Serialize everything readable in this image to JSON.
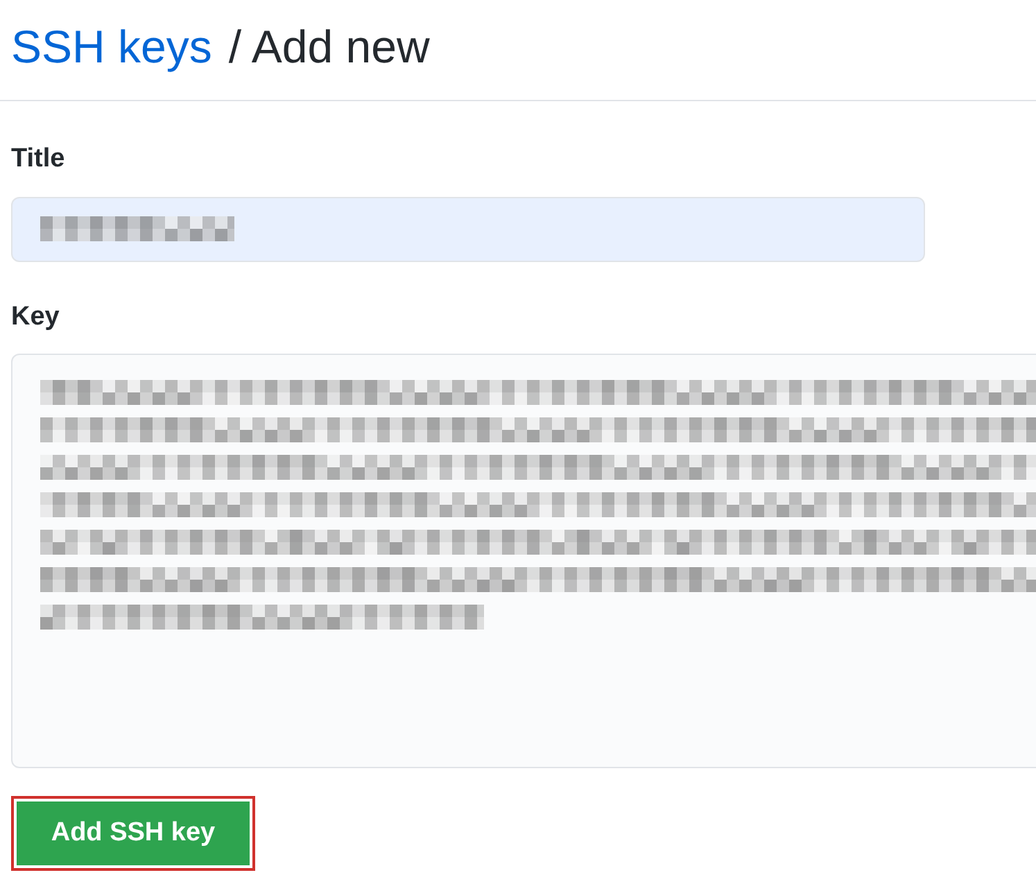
{
  "heading": {
    "link": "SSH keys",
    "rest": "/ Add new"
  },
  "title_field": {
    "label": "Title",
    "redacted": true,
    "autofilled": true
  },
  "key_field": {
    "label": "Key",
    "redacted": true
  },
  "buttons": [
    "Add SSH key"
  ],
  "highlight": {
    "on": true
  }
}
